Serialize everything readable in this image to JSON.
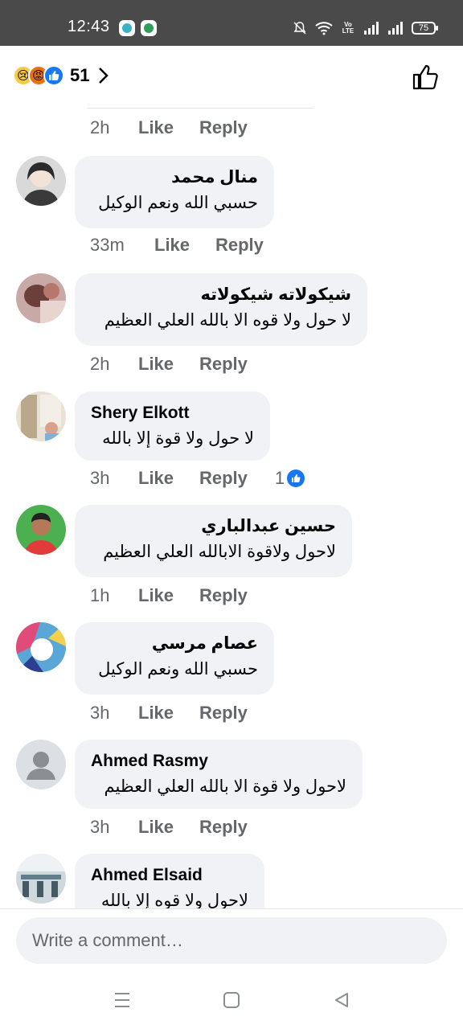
{
  "status_bar": {
    "time": "12:43",
    "battery": "75",
    "network_label": "Vo LTE"
  },
  "header": {
    "reaction_count": "51",
    "reaction_icons": [
      "sad-icon",
      "angry-icon",
      "like-icon"
    ]
  },
  "top_partial": {
    "time": "2h",
    "like": "Like",
    "reply": "Reply"
  },
  "comments": [
    {
      "name": "منال محمد",
      "text": "حسبي الله ونعم الوكيل",
      "time": "33m",
      "like": "Like",
      "reply": "Reply"
    },
    {
      "name": "شيكولاته شيكولاته",
      "text": "لا حول ولا قوه الا بالله العلي العظيم",
      "time": "2h",
      "like": "Like",
      "reply": "Reply"
    },
    {
      "name": "Shery Elkott",
      "text": "لا حول ولا قوة إلا بالله",
      "time": "3h",
      "like": "Like",
      "reply": "Reply",
      "reaction_count": "1"
    },
    {
      "name": "حسين عبدالباري",
      "text": "لاحول ولاقوة الابالله العلي العظيم",
      "time": "1h",
      "like": "Like",
      "reply": "Reply"
    },
    {
      "name": "عصام مرسي",
      "text": "حسبي الله ونعم الوكيل",
      "time": "3h",
      "like": "Like",
      "reply": "Reply"
    },
    {
      "name": "Ahmed Rasmy",
      "text": "لاحول ولا قوة الا بالله العلي العظيم",
      "time": "3h",
      "like": "Like",
      "reply": "Reply"
    },
    {
      "name": "Ahmed Elsaid",
      "text": "لاحول ولا قوه إلا بالله"
    }
  ],
  "composer": {
    "placeholder": "Write a comment…"
  },
  "colors": {
    "accent": "#1877f2",
    "bubble": "#f0f2f5",
    "meta": "#65676b",
    "status_bar": "#4a4a4a"
  }
}
